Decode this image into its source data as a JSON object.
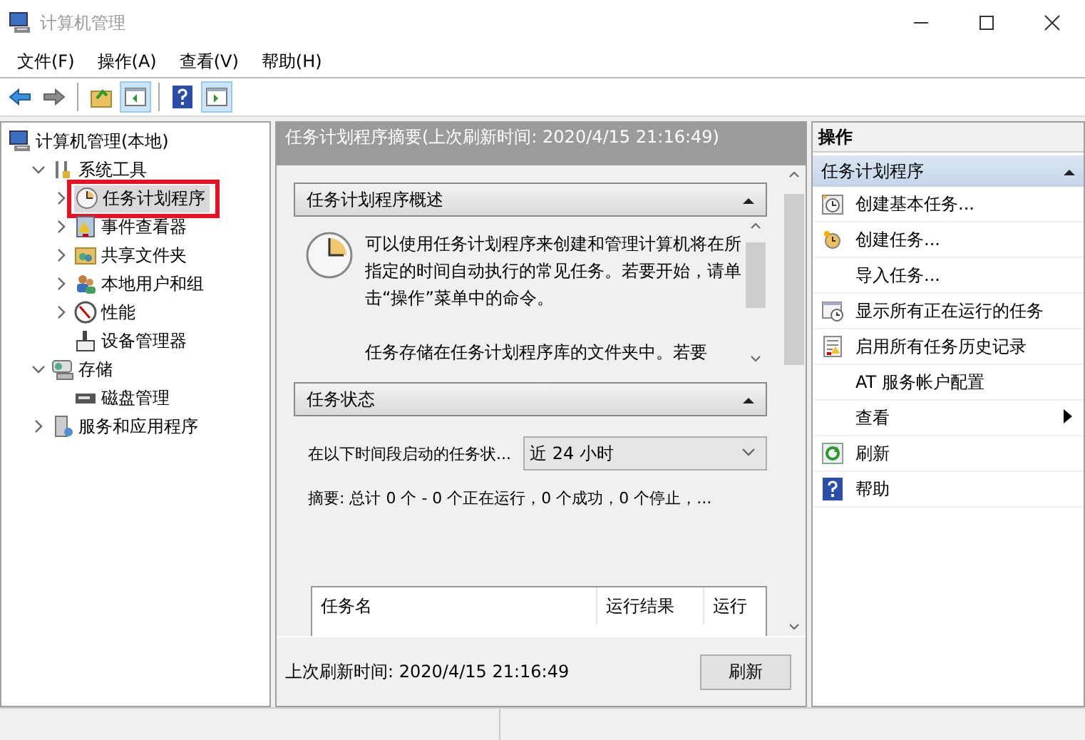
{
  "window": {
    "title": "计算机管理"
  },
  "menu": [
    "文件(F)",
    "操作(A)",
    "查看(V)",
    "帮助(H)"
  ],
  "toolbar": [
    {
      "kind": "back",
      "pressed": false
    },
    {
      "kind": "forward",
      "pressed": false
    },
    {
      "kind": "separator"
    },
    {
      "kind": "up",
      "pressed": false
    },
    {
      "kind": "tree-pane",
      "pressed": true
    },
    {
      "kind": "separator"
    },
    {
      "kind": "help",
      "pressed": false
    },
    {
      "kind": "action-pane",
      "pressed": true
    }
  ],
  "tree": [
    {
      "label": "计算机管理(本地)",
      "selected": false,
      "highlighted": false,
      "children": [
        {
          "label": "系统工具",
          "expanded": true,
          "selected": false,
          "highlighted": false,
          "children": [
            {
              "label": "任务计划程序",
              "expanded": false,
              "selected": true,
              "highlighted": true
            },
            {
              "label": "事件查看器",
              "expanded": false,
              "selected": false,
              "highlighted": false
            },
            {
              "label": "共享文件夹",
              "expanded": false,
              "selected": false,
              "highlighted": false
            },
            {
              "label": "本地用户和组",
              "expanded": false,
              "selected": false,
              "highlighted": false
            },
            {
              "label": "性能",
              "expanded": false,
              "selected": false,
              "highlighted": false
            },
            {
              "label": "设备管理器",
              "selected": false,
              "highlighted": false
            }
          ]
        },
        {
          "label": "存储",
          "expanded": true,
          "selected": false,
          "highlighted": false,
          "children": [
            {
              "label": "磁盘管理",
              "selected": false,
              "highlighted": false
            }
          ]
        },
        {
          "label": "服务和应用程序",
          "expanded": false,
          "selected": false,
          "highlighted": false
        }
      ]
    }
  ],
  "center": {
    "title": "任务计划程序摘要(上次刷新时间: 2020/4/15 21:16:49)",
    "sections": [
      {
        "kind": "overview",
        "title": "任务计划程序概述",
        "expanded": true,
        "paragraphs": [
          "可以使用任务计划程序来创建和管理计算机将在所指定的时间自动执行的常见任务。若要开始，请单击“操作”菜单中的命令。",
          "任务存储在任务计划程序库的文件夹中。若要"
        ]
      },
      {
        "kind": "status",
        "title": "任务状态",
        "expanded": true,
        "filter_label": "在以下时间段启动的任务状...",
        "filter_value": "近 24 小时",
        "summary": "摘要: 总计 0 个 - 0 个正在运行，0 个成功，0 个停止，...",
        "columns": [
          "任务名",
          "运行结果",
          "运行"
        ]
      }
    ],
    "footer": {
      "text": "上次刷新时间: 2020/4/15 21:16:49",
      "button": "刷新"
    }
  },
  "actions": {
    "title": "操作",
    "sections": [
      {
        "title": "任务计划程序",
        "expanded": true,
        "items": [
          {
            "label": "创建基本任务...",
            "submenu": false
          },
          {
            "label": "创建任务...",
            "submenu": false
          },
          {
            "label": "导入任务...",
            "submenu": false
          },
          {
            "label": "显示所有正在运行的任务",
            "submenu": false
          },
          {
            "label": "启用所有任务历史记录",
            "submenu": false
          },
          {
            "label": "AT 服务帐户配置",
            "submenu": false
          },
          {
            "label": "查看",
            "submenu": true
          },
          {
            "label": "刷新",
            "submenu": false
          },
          {
            "label": "帮助",
            "submenu": false
          }
        ]
      }
    ]
  }
}
